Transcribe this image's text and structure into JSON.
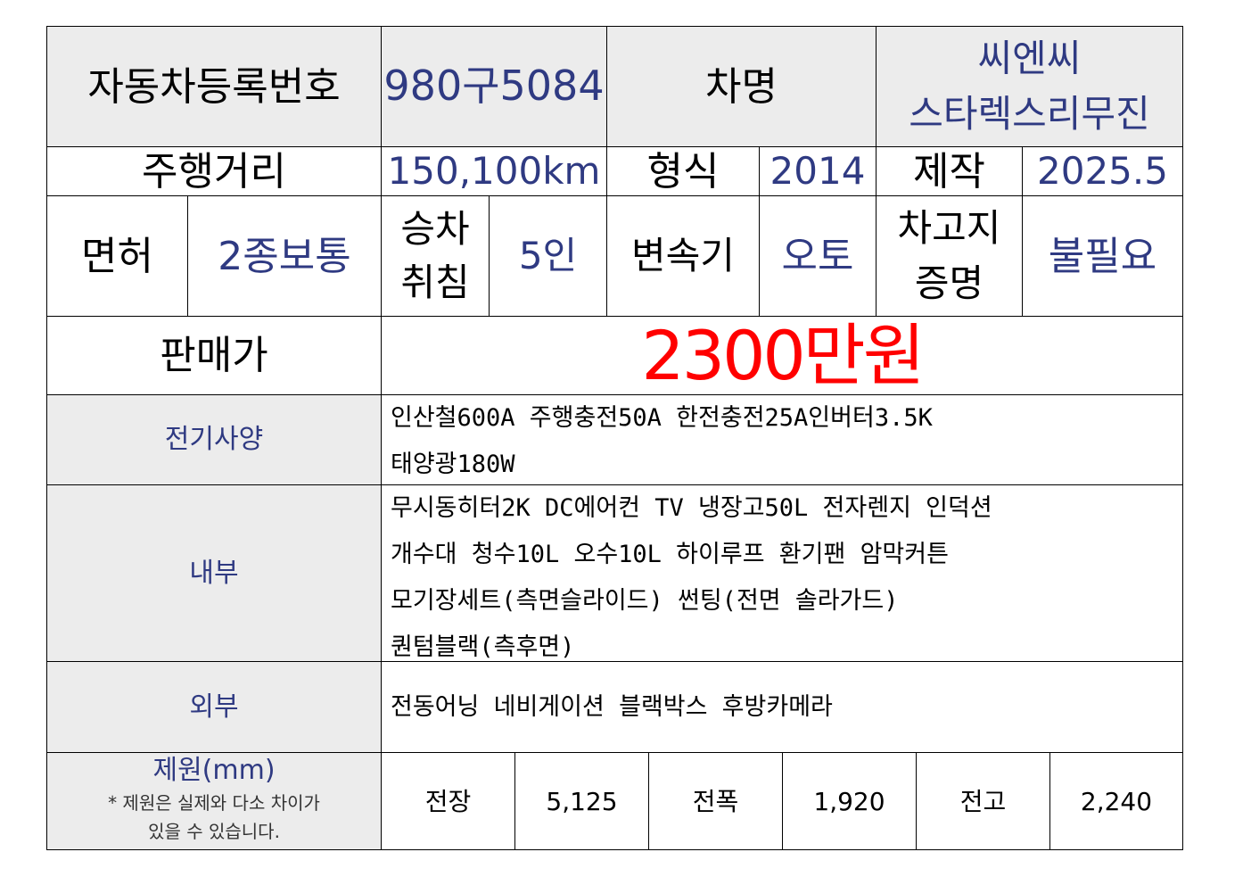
{
  "row1": {
    "reg_label": "자동차등록번호",
    "reg_value": "980구5084",
    "name_label": "차명",
    "name_line1": "씨엔씨",
    "name_line2": "스타렉스리무진"
  },
  "row2": {
    "mileage_label": "주행거리",
    "mileage_value": "150,100km",
    "model_label": "형식",
    "model_value": "2014",
    "made_label": "제작",
    "made_value": "2025.5"
  },
  "row3": {
    "license_label": "면허",
    "license_value": "2종보통",
    "capacity_label_1": "승차",
    "capacity_label_2": "취침",
    "capacity_value": "5인",
    "transmission_label": "변속기",
    "transmission_value": "오토",
    "garage_label_1": "차고지",
    "garage_label_2": "증명",
    "garage_value": "불필요"
  },
  "price": {
    "label": "판매가",
    "value": "2300만원"
  },
  "electrical": {
    "label": "전기사양",
    "lines": [
      "인산철600A 주행충전50A 한전충전25A인버터3.5K",
      "태양광180W"
    ]
  },
  "interior": {
    "label": "내부",
    "lines": [
      "무시동히터2K DC에어컨 TV 냉장고50L 전자렌지 인덕션",
      "개수대 청수10L 오수10L 하이루프 환기팬 암막커튼",
      "모기장세트(측면슬라이드) 썬팅(전면 솔라가드)",
      "퀀텀블랙(측후면)"
    ]
  },
  "exterior": {
    "label": "외부",
    "lines": [
      "전동어닝 네비게이션 블랙박스 후방카메라"
    ]
  },
  "dimensions": {
    "label": "제원(mm)",
    "note_1": "* 제원은 실제와 다소 차이가",
    "note_2": "있을 수 있습니다.",
    "length_label": "전장",
    "length_value": "5,125",
    "width_label": "전폭",
    "width_value": "1,920",
    "height_label": "전고",
    "height_value": "2,240"
  }
}
